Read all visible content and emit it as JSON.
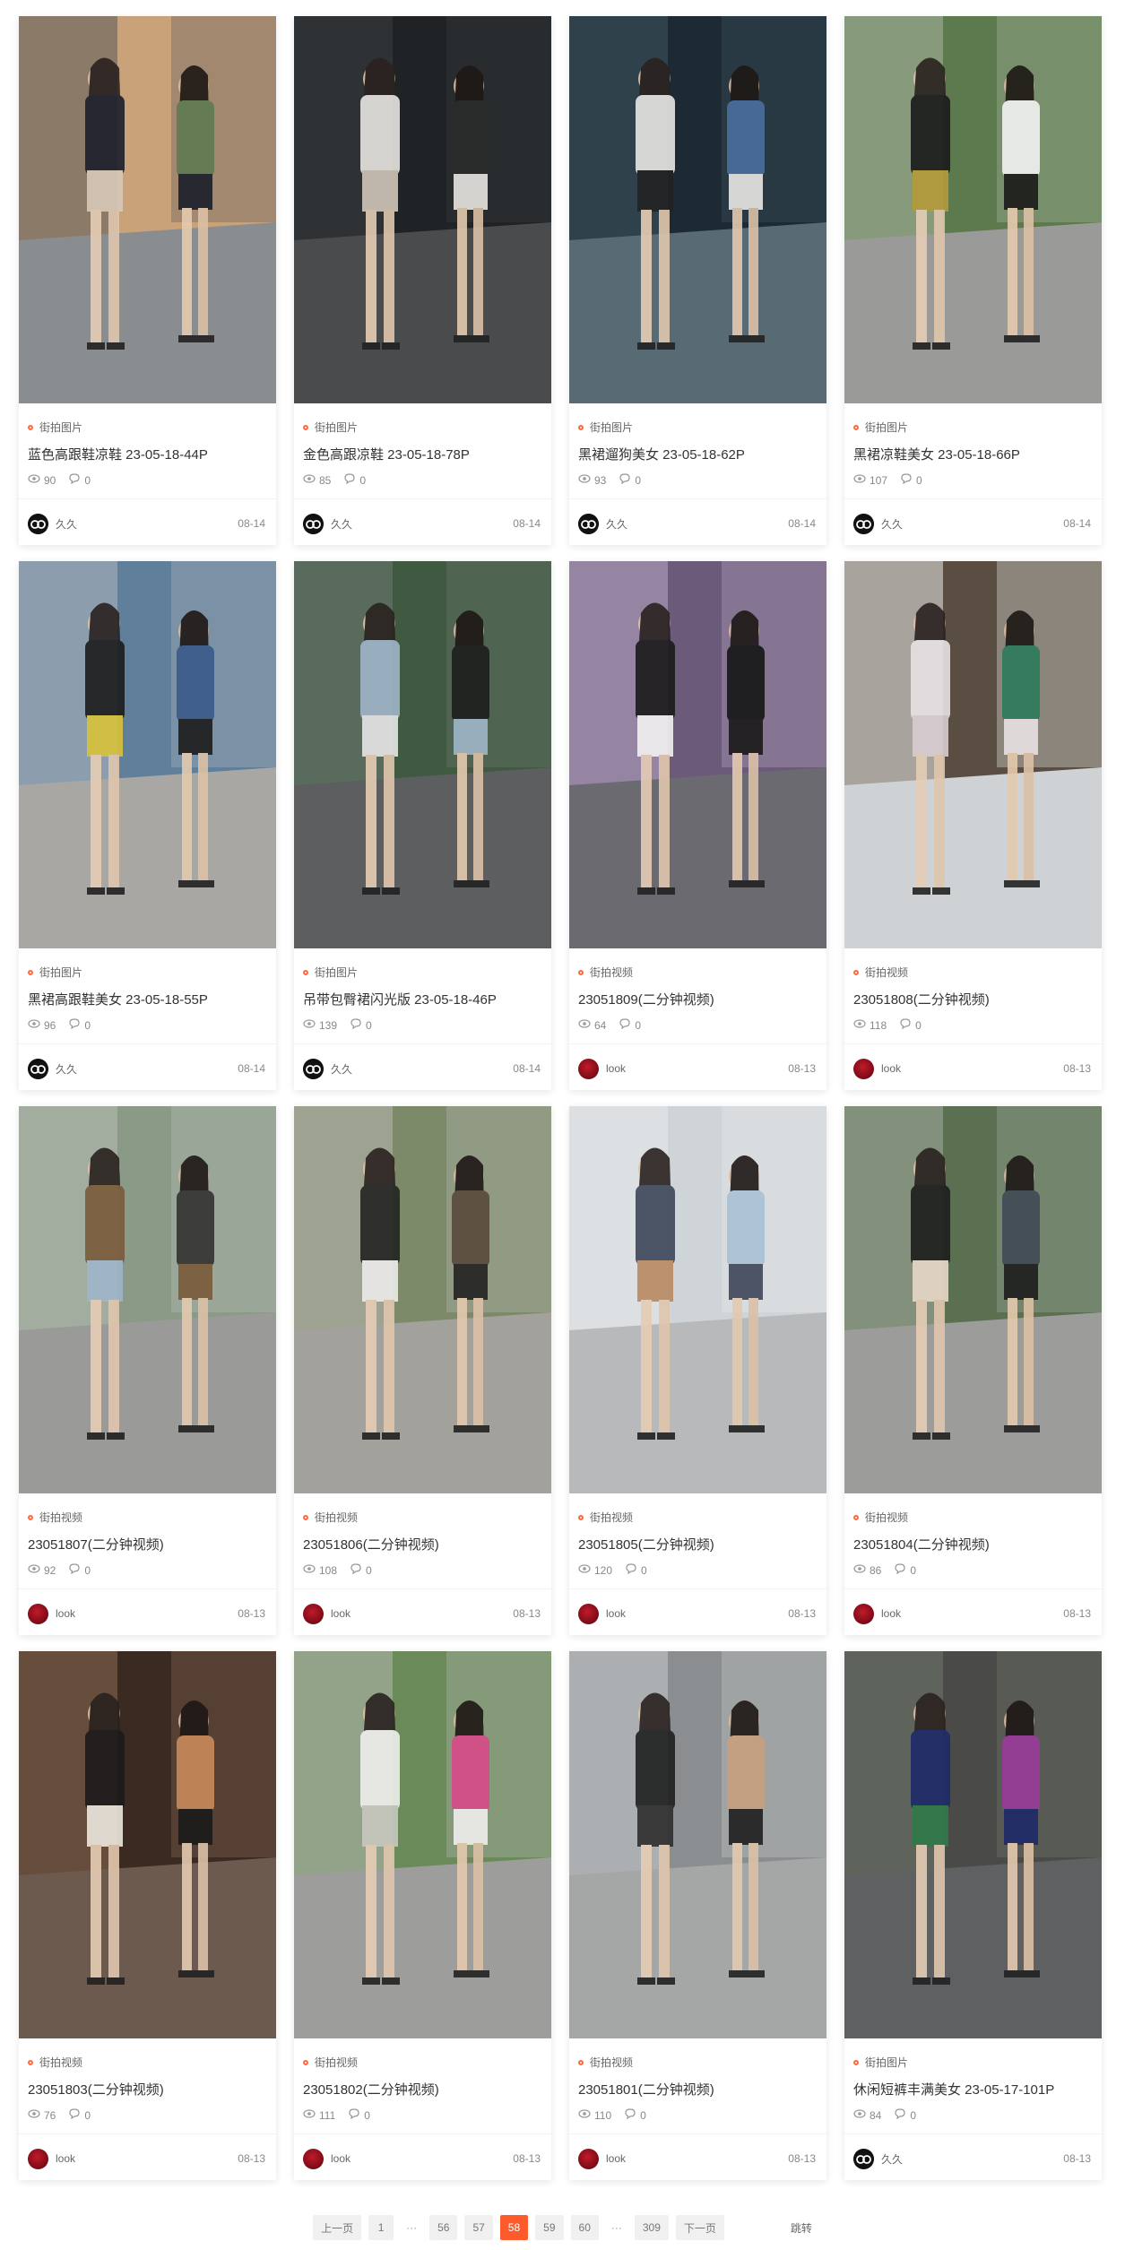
{
  "cards": [
    {
      "category": "街拍图片",
      "title": "蓝色高跟鞋凉鞋 23-05-18-44P",
      "views": "90",
      "comments": "0",
      "author": "久久",
      "avatar": "a1",
      "date": "08-14",
      "scene": {
        "bg1": "#c9a27a",
        "bg2": "#5a5a5a",
        "ground": "#8a8d90",
        "p1": "#1b1f2a",
        "p2": "#d8c8b8",
        "p3": "#5f7a52"
      }
    },
    {
      "category": "街拍图片",
      "title": "金色高跟凉鞋 23-05-18-78P",
      "views": "85",
      "comments": "0",
      "author": "久久",
      "avatar": "a1",
      "date": "08-14",
      "scene": {
        "bg1": "#1f2326",
        "bg2": "#3b3f42",
        "ground": "#4a4b4d",
        "p1": "#e8e6e2",
        "p2": "#cfc6b8",
        "p3": "#2a2a2a"
      }
    },
    {
      "category": "街拍图片",
      "title": "黑裙遛狗美女 23-05-18-62P",
      "views": "93",
      "comments": "0",
      "author": "久久",
      "avatar": "a1",
      "date": "08-14",
      "scene": {
        "bg1": "#1d2a33",
        "bg2": "#3e5560",
        "ground": "#586a74",
        "p1": "#e9e7e4",
        "p2": "#222",
        "p3": "#4a6fa0"
      }
    },
    {
      "category": "街拍图片",
      "title": "黑裙凉鞋美女 23-05-18-66P",
      "views": "107",
      "comments": "0",
      "author": "久久",
      "avatar": "a1",
      "date": "08-14",
      "scene": {
        "bg1": "#5d7a4e",
        "bg2": "#a9b6a2",
        "ground": "#9a9a98",
        "p1": "#1a1a1a",
        "p2": "#b59a3a",
        "p3": "#f2f2f2"
      }
    },
    {
      "category": "街拍图片",
      "title": "黑裙高跟鞋美女 23-05-18-55P",
      "views": "96",
      "comments": "0",
      "author": "久久",
      "avatar": "a1",
      "date": "08-14",
      "scene": {
        "bg1": "#5f7f9a",
        "bg2": "#b1b8bd",
        "ground": "#a9a7a3",
        "p1": "#1c1c1c",
        "p2": "#d9c23a",
        "p3": "#3a5a8a"
      }
    },
    {
      "category": "街拍图片",
      "title": "吊带包臀裙闪光版 23-05-18-46P",
      "views": "139",
      "comments": "0",
      "author": "久久",
      "avatar": "a1",
      "date": "08-14",
      "scene": {
        "bg1": "#3f5a40",
        "bg2": "#707a72",
        "ground": "#5c5e60",
        "p1": "#9fb6c9",
        "p2": "#e6e6e6",
        "p3": "#1e1e1e"
      }
    },
    {
      "category": "街拍视频",
      "title": "23051809(二分钟视频)",
      "views": "64",
      "comments": "0",
      "author": "look",
      "avatar": "a2",
      "date": "08-13",
      "scene": {
        "bg1": "#6b5a7a",
        "bg2": "#b8a9c4",
        "ground": "#6a6a70",
        "p1": "#1a1a1a",
        "p2": "#f1f1f1",
        "p3": "#151515"
      }
    },
    {
      "category": "街拍视频",
      "title": "23051808(二分钟视频)",
      "views": "118",
      "comments": "0",
      "author": "look",
      "avatar": "a2",
      "date": "08-13",
      "scene": {
        "bg1": "#5a4d42",
        "bg2": "#e9ede9",
        "ground": "#cfd2d4",
        "p1": "#e7e2e4",
        "p2": "#d8ccd0",
        "p3": "#2c7a5a"
      }
    },
    {
      "category": "街拍视频",
      "title": "23051807(二分钟视频)",
      "views": "92",
      "comments": "0",
      "author": "look",
      "avatar": "a2",
      "date": "08-13",
      "scene": {
        "bg1": "#8a9a86",
        "bg2": "#b7bdb6",
        "ground": "#9a9b99",
        "p1": "#7a5a3a",
        "p2": "#9fb5c8",
        "p3": "#333"
      }
    },
    {
      "category": "街拍视频",
      "title": "23051806(二分钟视频)",
      "views": "108",
      "comments": "0",
      "author": "look",
      "avatar": "a2",
      "date": "08-13",
      "scene": {
        "bg1": "#7c8a6a",
        "bg2": "#b9b8b0",
        "ground": "#a3a19c",
        "p1": "#232323",
        "p2": "#ecebea",
        "p3": "#5a4a3a"
      }
    },
    {
      "category": "街拍视频",
      "title": "23051805(二分钟视频)",
      "views": "120",
      "comments": "0",
      "author": "look",
      "avatar": "a2",
      "date": "08-13",
      "scene": {
        "bg1": "#cfd4d8",
        "bg2": "#e9eaeb",
        "ground": "#b7b9ba",
        "p1": "#3d4658",
        "p2": "#b98a62",
        "p3": "#a9c2d6"
      }
    },
    {
      "category": "街拍视频",
      "title": "23051804(二分钟视频)",
      "views": "86",
      "comments": "0",
      "author": "look",
      "avatar": "a2",
      "date": "08-13",
      "scene": {
        "bg1": "#5a7050",
        "bg2": "#a4aca0",
        "ground": "#9c9d9b",
        "p1": "#1d1d1d",
        "p2": "#e7d8c8",
        "p3": "#404a55"
      }
    },
    {
      "category": "街拍视频",
      "title": "23051803(二分钟视频)",
      "views": "76",
      "comments": "0",
      "author": "look",
      "avatar": "a2",
      "date": "08-13",
      "scene": {
        "bg1": "#3a2a22",
        "bg2": "#8a6a52",
        "ground": "#6d5a4e",
        "p1": "#1b1b1b",
        "p2": "#ede8df",
        "p3": "#c98a5a"
      }
    },
    {
      "category": "街拍视频",
      "title": "23051802(二分钟视频)",
      "views": "111",
      "comments": "0",
      "author": "look",
      "avatar": "a2",
      "date": "08-13",
      "scene": {
        "bg1": "#6a8a5a",
        "bg2": "#b5b8b2",
        "ground": "#9d9e9b",
        "p1": "#f0efed",
        "p2": "#c8c8c0",
        "p3": "#d84a8a"
      }
    },
    {
      "category": "街拍视频",
      "title": "23051801(二分钟视频)",
      "views": "110",
      "comments": "0",
      "author": "look",
      "avatar": "a2",
      "date": "08-13",
      "scene": {
        "bg1": "#8a8e90",
        "bg2": "#c9cbcc",
        "ground": "#a5a6a6",
        "p1": "#1f1f1f",
        "p2": "#2e2e2e",
        "p3": "#c8a080"
      }
    },
    {
      "category": "街拍图片",
      "title": "休闲短裤丰满美女 23-05-17-101P",
      "views": "84",
      "comments": "0",
      "author": "久久",
      "avatar": "a1",
      "date": "08-13",
      "scene": {
        "bg1": "#4a4a48",
        "bg2": "#6f7a6c",
        "ground": "#5f6062",
        "p1": "#1e2a6a",
        "p2": "#2f7a4a",
        "p3": "#9a3a9a"
      }
    }
  ],
  "pagination": {
    "prev": "上一页",
    "pages_left": [
      "1"
    ],
    "ellipsis": "···",
    "pages_mid": [
      "56",
      "57",
      "58",
      "59",
      "60"
    ],
    "current": "58",
    "pages_right": [
      "309"
    ],
    "next": "下一页",
    "jump": "跳转"
  },
  "colors": {
    "accent": "#ff5a2c",
    "category_dot": "#ff6a3d"
  }
}
